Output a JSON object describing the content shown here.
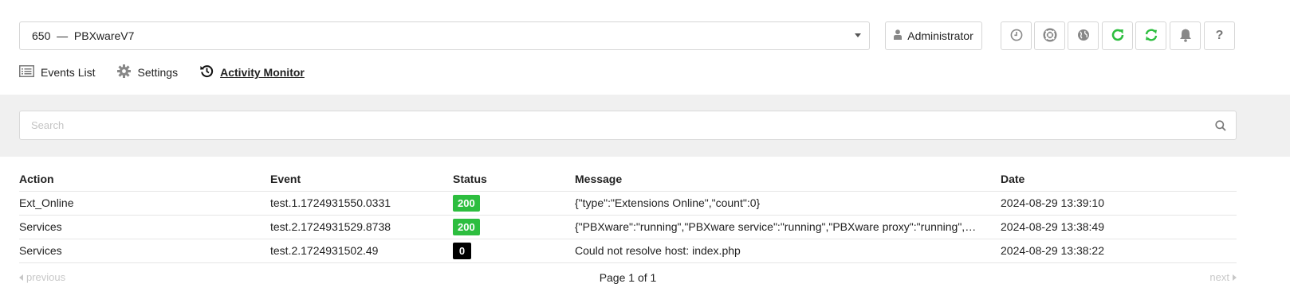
{
  "header": {
    "server_select": {
      "value": "650  —  PBXwareV7"
    },
    "user_button": {
      "label": "Administrator"
    },
    "toolbar_icons": [
      {
        "name": "clock-icon"
      },
      {
        "name": "lifebuoy-icon"
      },
      {
        "name": "globe-icon"
      },
      {
        "name": "refresh-icon"
      },
      {
        "name": "sync-icon"
      },
      {
        "name": "bell-icon"
      },
      {
        "name": "help-icon",
        "glyph": "?"
      }
    ],
    "colors": {
      "refresh_green": "#2dbe3f",
      "icon_gray": "#888888"
    }
  },
  "nav": {
    "items": [
      {
        "label": "Events List",
        "icon": "list-icon"
      },
      {
        "label": "Settings",
        "icon": "gear-icon"
      },
      {
        "label": "Activity Monitor",
        "icon": "history-icon",
        "active": true
      }
    ]
  },
  "search": {
    "placeholder": "Search",
    "value": ""
  },
  "table": {
    "columns": [
      "Action",
      "Event",
      "Status",
      "Message",
      "Date"
    ],
    "rows": [
      {
        "action": "Ext_Online",
        "event": "test.1.1724931550.0331",
        "status": "200",
        "status_color": "green",
        "message": "{\"type\":\"Extensions Online\",\"count\":0}",
        "date": "2024-08-29 13:39:10"
      },
      {
        "action": "Services",
        "event": "test.2.1724931529.8738",
        "status": "200",
        "status_color": "green",
        "message": "{\"PBXware\":\"running\",\"PBXware service\":\"running\",\"PBXware proxy\":\"running\",\"Push…",
        "date": "2024-08-29 13:38:49"
      },
      {
        "action": "Services",
        "event": "test.2.1724931502.49",
        "status": "0",
        "status_color": "black",
        "message": "Could not resolve host: index.php",
        "date": "2024-08-29 13:38:22"
      }
    ]
  },
  "pagination": {
    "previous_label": "previous",
    "page_label": "Page 1 of 1",
    "next_label": "next"
  }
}
